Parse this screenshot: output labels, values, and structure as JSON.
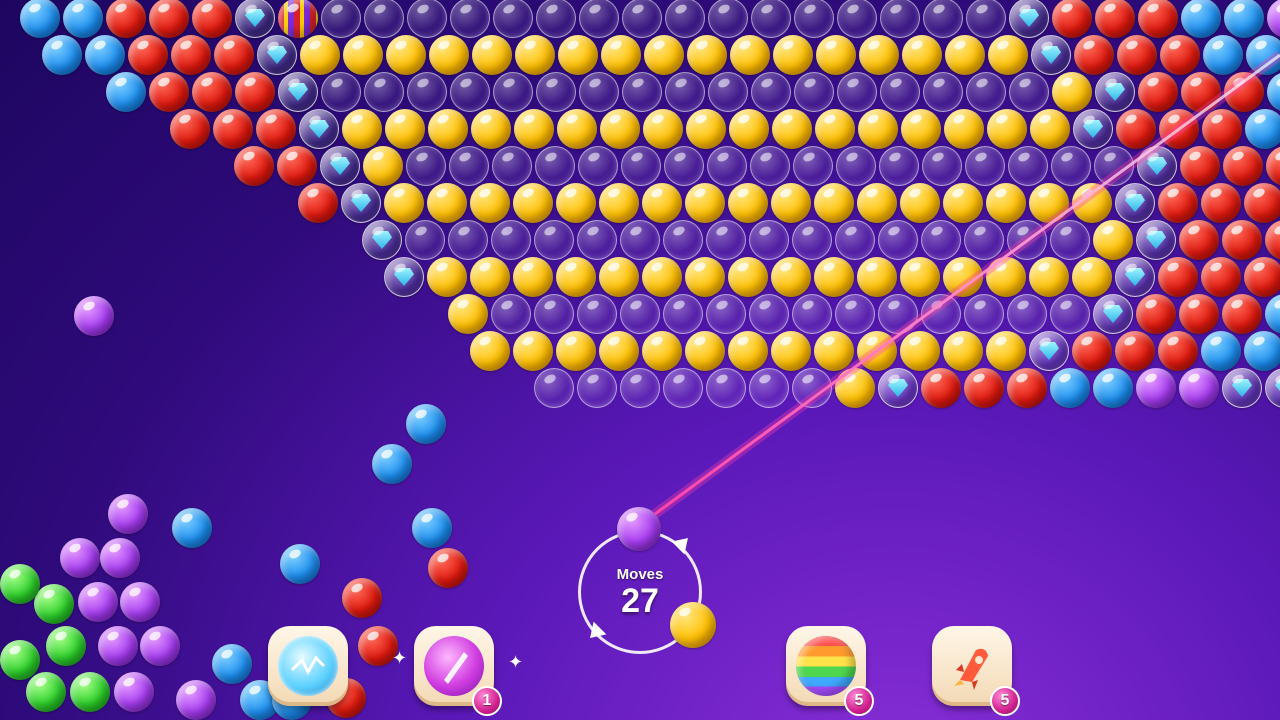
{
  "hud": {
    "moves_label": "Moves",
    "moves_count": "27"
  },
  "shooter": {
    "current_bubble_color": "purple",
    "next_bubble_color": "yellow",
    "aim_line_color": "#ff3fa8"
  },
  "boosters": [
    {
      "name": "lightning-booster",
      "count": ""
    },
    {
      "name": "magic-brush-booster",
      "count": "1"
    },
    {
      "name": "rainbow-ball-booster",
      "count": "5"
    },
    {
      "name": "rocket-booster",
      "count": "5"
    }
  ],
  "board": {
    "rows": [
      "BBRRRGSEEEEEEEEEEEEEEEEGRRRBBP",
      "BBRRRGYYYYYYYYYYYYYYYYYGRRRBBPP",
      "BRRRGEEEEEEEEEEEEEEEEEYGRRRBBPP",
      "RRRGYYYYYYYYYYYYYYYYYGRRRBBPPP",
      "RRGYEEEEEEEEEEEEEEEEEGRRRBBPPG",
      "RGYYYYYYYYYYYYYYYYYGRRRBBPPGG",
      "GEEEEEEEEEEEEEEEEYGRRRBBPPGG",
      "GYYYYYYYYYYYYYYYYGRRRBBPPGG",
      "YEEEEEEEEEEEEEEGRRRBBPPGGY",
      "YYYYYYYYYYYYYGRRRBBPPGGY",
      "EEEEEEEYGRRRBBPPGGYY"
    ],
    "legend": {
      "R": "red",
      "Y": "yellow",
      "B": "blue",
      "P": "purple",
      "G": "diamond-empty",
      "E": "empty-glass",
      "S": "striped"
    }
  },
  "colors": {
    "red": "#e0190f",
    "yellow": "#ffbf00",
    "blue": "#1e8ff0",
    "purple": "#a53bf0",
    "green": "#2ccf2a",
    "background": "#3a0e92"
  },
  "falling_bubbles": [
    "purple",
    "blue",
    "blue",
    "blue",
    "blue",
    "blue",
    "red",
    "red",
    "red",
    "blue",
    "blue",
    "purple",
    "purple",
    "purple",
    "purple",
    "purple",
    "purple",
    "purple",
    "green",
    "green",
    "green",
    "green",
    "green",
    "green",
    "purple",
    "purple",
    "red",
    "blue"
  ]
}
